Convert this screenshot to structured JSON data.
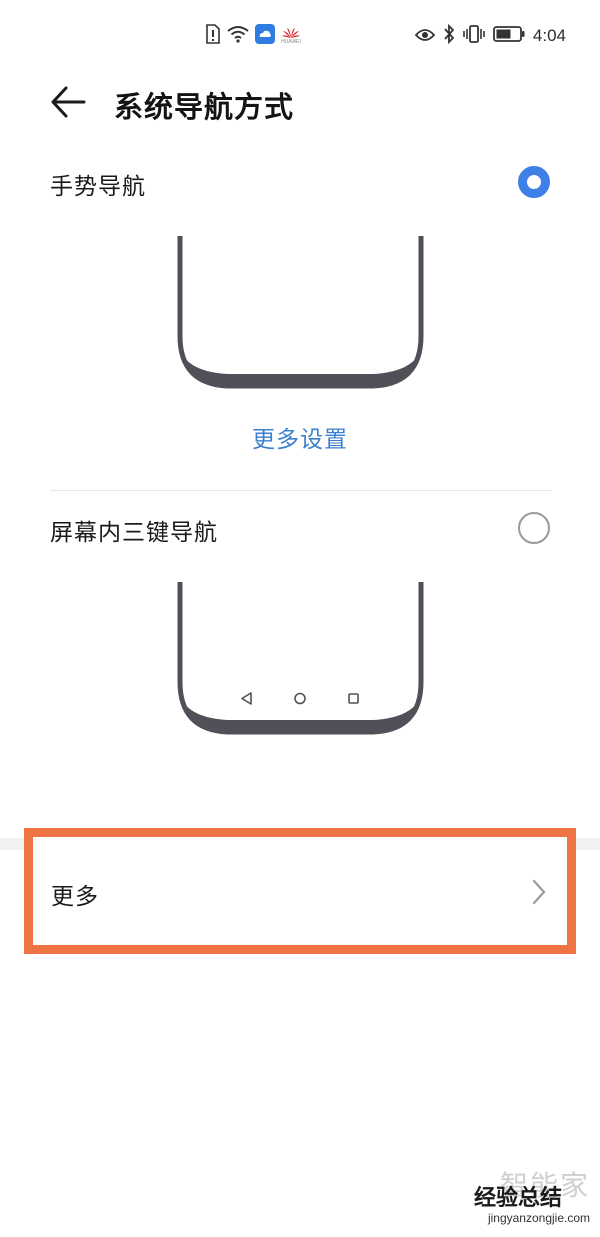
{
  "status_bar": {
    "time": "4:04",
    "carrier_logo_text": "HUAWEI",
    "icons": [
      "alert-icon",
      "wifi-icon",
      "cloud-icon",
      "huawei-logo-icon",
      "eye-icon",
      "bluetooth-icon",
      "vibrate-icon",
      "battery-icon"
    ]
  },
  "header": {
    "title": "系统导航方式"
  },
  "options": [
    {
      "label": "手势导航",
      "selected": true
    },
    {
      "label": "屏幕内三键导航",
      "selected": false
    }
  ],
  "gesture": {
    "more_settings_label": "更多设置"
  },
  "more": {
    "label": "更多"
  },
  "watermark": {
    "top": "智能家",
    "middle": "经验总结",
    "url": "jingyanzongjie.com"
  },
  "colors": {
    "accent": "#3e7fe8",
    "link": "#3c80cc",
    "highlight_border": "#ef7444",
    "phone_frame": "#505058"
  }
}
